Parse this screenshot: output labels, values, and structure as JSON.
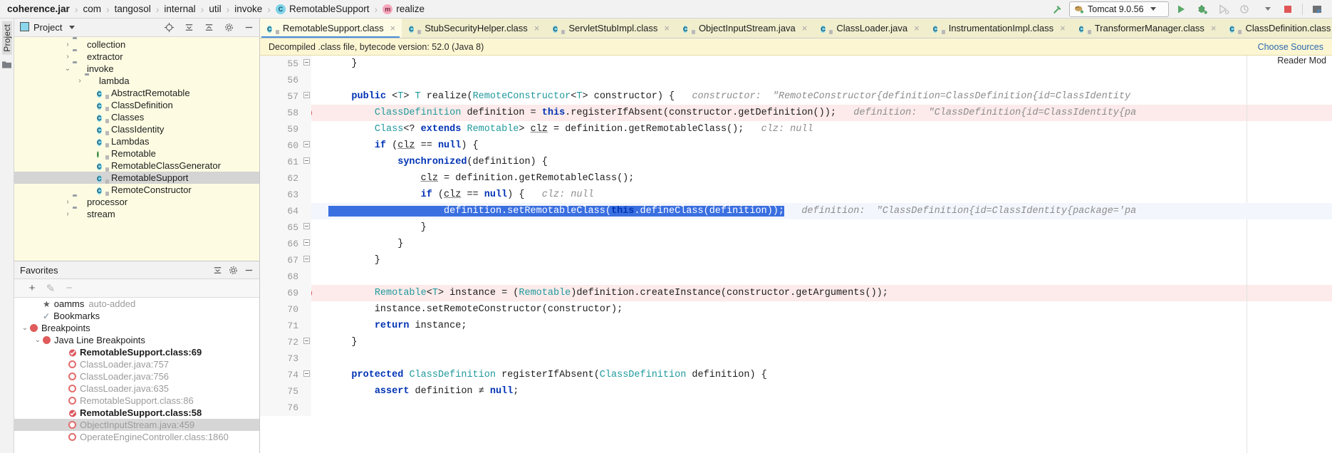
{
  "window": {
    "breadcrumb": [
      {
        "label": "coherence.jar",
        "icon": "",
        "root": true
      },
      {
        "label": "com",
        "icon": ""
      },
      {
        "label": "tangosol",
        "icon": ""
      },
      {
        "label": "internal",
        "icon": ""
      },
      {
        "label": "util",
        "icon": ""
      },
      {
        "label": "invoke",
        "icon": ""
      },
      {
        "label": "RemotableSupport",
        "icon": "class-badge-icon"
      },
      {
        "label": "realize",
        "icon": "method-badge-icon"
      }
    ],
    "toolbar": {
      "build_icon": "hammer-icon",
      "run_config": "Tomcat 9.0.56",
      "run_config_icon": "tomcat-icon",
      "run_icon": "run-icon",
      "debug_icon": "debug-icon",
      "run_with_coverage_icon": "run-coverage-icon",
      "profile_icon": "profiler-icon",
      "stop_icon": "stop-icon",
      "more_icon": "layout-icon"
    }
  },
  "rail": {
    "label": "Project",
    "icon": "project-folder-icon"
  },
  "sidebar": {
    "project_panel": {
      "title": "Project",
      "dropdown_icon": "chevron-down-icon",
      "icons": [
        "locate-icon",
        "collapse-all-icon",
        "expand-all-icon",
        "gear-icon",
        "hide-icon"
      ],
      "tree": [
        {
          "indent": 4,
          "arrow": "›",
          "icon": "folder-icon",
          "label": "collection"
        },
        {
          "indent": 4,
          "arrow": "›",
          "icon": "folder-icon",
          "label": "extractor"
        },
        {
          "indent": 4,
          "arrow": "⌄",
          "icon": "folder-icon",
          "label": "invoke"
        },
        {
          "indent": 5,
          "arrow": "›",
          "icon": "folder-icon",
          "label": "lambda"
        },
        {
          "indent": 6,
          "arrow": "",
          "icon": "class-icon",
          "label": "AbstractRemotable"
        },
        {
          "indent": 6,
          "arrow": "",
          "icon": "class-icon",
          "label": "ClassDefinition"
        },
        {
          "indent": 6,
          "arrow": "",
          "icon": "class-icon",
          "label": "Classes"
        },
        {
          "indent": 6,
          "arrow": "",
          "icon": "class-icon",
          "label": "ClassIdentity"
        },
        {
          "indent": 6,
          "arrow": "",
          "icon": "class-icon",
          "label": "Lambdas"
        },
        {
          "indent": 6,
          "arrow": "",
          "icon": "interface-icon",
          "label": "Remotable"
        },
        {
          "indent": 6,
          "arrow": "",
          "icon": "class-icon",
          "label": "RemotableClassGenerator"
        },
        {
          "indent": 6,
          "arrow": "",
          "icon": "class-icon",
          "label": "RemotableSupport",
          "selected": true
        },
        {
          "indent": 6,
          "arrow": "",
          "icon": "class-icon",
          "label": "RemoteConstructor"
        },
        {
          "indent": 4,
          "arrow": "›",
          "icon": "folder-icon",
          "label": "processor"
        },
        {
          "indent": 4,
          "arrow": "›",
          "icon": "folder-icon",
          "label": "stream"
        }
      ]
    },
    "favorites_panel": {
      "title": "Favorites",
      "icons": [
        "collapse-all-icon",
        "gear-icon",
        "hide-icon"
      ],
      "toolbar": {
        "add": "+",
        "edit": "✎",
        "remove": "−"
      },
      "items": [
        {
          "indent": 1,
          "arrow": "",
          "icon": "star-icon",
          "label": "oamms",
          "sublabel": "auto-added"
        },
        {
          "indent": 1,
          "arrow": "",
          "icon": "bookmark-check-icon",
          "label": "Bookmarks"
        },
        {
          "indent": 0,
          "arrow": "⌄",
          "icon": "breakpoint-dot-icon",
          "label": "Breakpoints"
        },
        {
          "indent": 1,
          "arrow": "⌄",
          "icon": "breakpoint-dot-icon",
          "label": "Java Line Breakpoints"
        },
        {
          "indent": 3,
          "arrow": "",
          "icon": "breakpoint-verified-icon",
          "label": "RemotableSupport.class:69",
          "bold": true
        },
        {
          "indent": 3,
          "arrow": "",
          "icon": "breakpoint-ring-icon",
          "label": "ClassLoader.java:757",
          "muted": true
        },
        {
          "indent": 3,
          "arrow": "",
          "icon": "breakpoint-ring-icon",
          "label": "ClassLoader.java:756",
          "muted": true
        },
        {
          "indent": 3,
          "arrow": "",
          "icon": "breakpoint-ring-icon",
          "label": "ClassLoader.java:635",
          "muted": true
        },
        {
          "indent": 3,
          "arrow": "",
          "icon": "breakpoint-ring-icon",
          "label": "RemotableSupport.class:86",
          "muted": true
        },
        {
          "indent": 3,
          "arrow": "",
          "icon": "breakpoint-verified-icon",
          "label": "RemotableSupport.class:58",
          "bold": true
        },
        {
          "indent": 3,
          "arrow": "",
          "icon": "breakpoint-ring-icon",
          "label": "ObjectInputStream.java:459",
          "muted": true,
          "selected": true
        },
        {
          "indent": 3,
          "arrow": "",
          "icon": "breakpoint-ring-icon",
          "label": "OperateEngineController.class:1860",
          "muted": true
        }
      ]
    }
  },
  "editor": {
    "tabs": [
      {
        "label": "RemotableSupport.class",
        "icon": "class-file-icon",
        "active": true,
        "close": "×"
      },
      {
        "label": "StubSecurityHelper.class",
        "icon": "class-file-icon",
        "close": "×"
      },
      {
        "label": "ServletStubImpl.class",
        "icon": "class-file-icon",
        "close": "×"
      },
      {
        "label": "ObjectInputStream.java",
        "icon": "class-file-icon",
        "close": "×"
      },
      {
        "label": "ClassLoader.java",
        "icon": "class-file-icon",
        "close": "×"
      },
      {
        "label": "InstrumentationImpl.class",
        "icon": "class-file-icon",
        "close": "×"
      },
      {
        "label": "TransformerManager.class",
        "icon": "class-file-icon",
        "close": "×"
      },
      {
        "label": "ClassDefinition.class",
        "icon": "class-file-icon",
        "close": "×"
      }
    ],
    "notice": {
      "text": "Decompiled .class file, bytecode version: 52.0 (Java 8)",
      "action": "Choose Sources"
    },
    "reader_mode": "Reader Mod",
    "lines": [
      {
        "n": "55",
        "fold": true,
        "code": "    }"
      },
      {
        "n": "56",
        "code": ""
      },
      {
        "n": "57",
        "fold": true,
        "code": "    public <T> T realize(RemoteConstructor<T> constructor) {",
        "hint": "constructor:  \"RemoteConstructor{definition=ClassDefinition{id=ClassIdentity"
      },
      {
        "n": "58",
        "breakpoint": "verified",
        "highlight": true,
        "code": "        ClassDefinition definition = this.registerIfAbsent(constructor.getDefinition());",
        "hint": "definition:  \"ClassDefinition{id=ClassIdentity{pa"
      },
      {
        "n": "59",
        "code": "        Class<? extends Remotable> clz = definition.getRemotableClass();",
        "hint": "clz: null"
      },
      {
        "n": "60",
        "fold": true,
        "code": "        if (clz == null) {"
      },
      {
        "n": "61",
        "fold": true,
        "code": "            synchronized(definition) {"
      },
      {
        "n": "62",
        "code": "                clz = definition.getRemotableClass();"
      },
      {
        "n": "63",
        "code": "                if (clz == null) {",
        "hint": "clz: null"
      },
      {
        "n": "64",
        "current": true,
        "selected": true,
        "code": "                    definition.setRemotableClass(this.defineClass(definition));",
        "hint": "definition:  \"ClassDefinition{id=ClassIdentity{package='pa"
      },
      {
        "n": "65",
        "fold": true,
        "code": "                }"
      },
      {
        "n": "66",
        "fold": true,
        "code": "            }"
      },
      {
        "n": "67",
        "fold": true,
        "code": "        }"
      },
      {
        "n": "68",
        "code": ""
      },
      {
        "n": "69",
        "breakpoint": "verified",
        "highlight": true,
        "code": "        Remotable<T> instance = (Remotable)definition.createInstance(constructor.getArguments());"
      },
      {
        "n": "70",
        "code": "        instance.setRemoteConstructor(constructor);"
      },
      {
        "n": "71",
        "code": "        return instance;"
      },
      {
        "n": "72",
        "fold": true,
        "code": "    }"
      },
      {
        "n": "73",
        "code": ""
      },
      {
        "n": "74",
        "fold": true,
        "code": "    protected ClassDefinition registerIfAbsent(ClassDefinition definition) {"
      },
      {
        "n": "75",
        "code": "        assert definition ≠ null;"
      },
      {
        "n": "76",
        "code": ""
      }
    ]
  },
  "colors": {
    "accent": "#2f5bd6",
    "keyword": "#0033b3",
    "type": "#20999d",
    "hint": "#8c8c8c",
    "breakpoint": "#e05b5b",
    "tab_bg": "#f0eecd",
    "tree_bg": "#fdfce2",
    "notice_bg": "#fdf6d3",
    "highlight_line": "#fcebea"
  }
}
